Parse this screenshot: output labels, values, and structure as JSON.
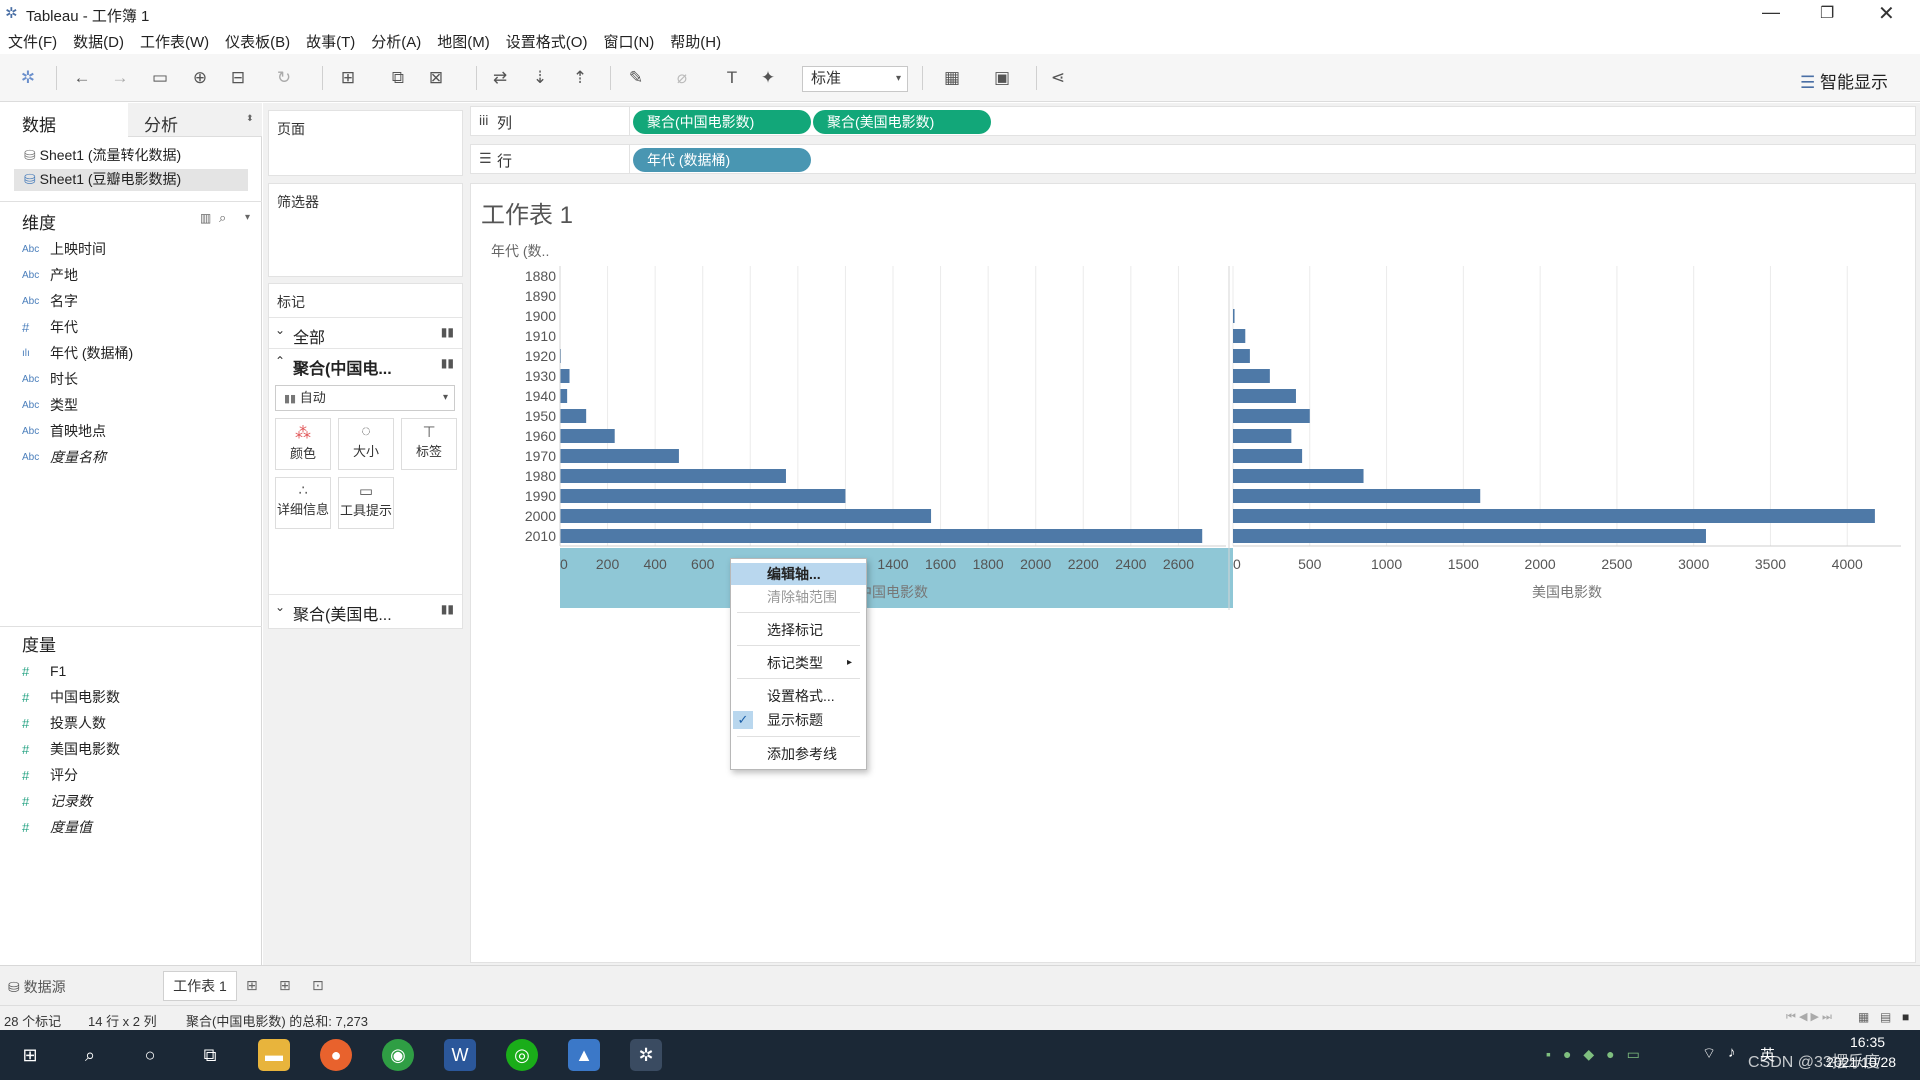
{
  "window": {
    "app_icon": "tableau-logo-icon",
    "title": "Tableau - 工作簿 1"
  },
  "menu": [
    "文件(F)",
    "数据(D)",
    "工作表(W)",
    "仪表板(B)",
    "故事(T)",
    "分析(A)",
    "地图(M)",
    "设置格式(O)",
    "窗口(N)",
    "帮助(H)"
  ],
  "toolbar": {
    "fit_select": "标准",
    "show_me": "智能显示"
  },
  "data_pane": {
    "tab_data": "数据",
    "tab_analysis": "分析",
    "sources": [
      "Sheet1 (流量转化数据)",
      "Sheet1 (豆瓣电影数据)"
    ],
    "dimensions_header": "维度",
    "dimensions": [
      {
        "type": "Abc",
        "name": "上映时间"
      },
      {
        "type": "Abc",
        "name": "产地"
      },
      {
        "type": "Abc",
        "name": "名字"
      },
      {
        "type": "#",
        "name": "年代"
      },
      {
        "type": "bins",
        "name": "年代 (数据桶)"
      },
      {
        "type": "Abc",
        "name": "时长"
      },
      {
        "type": "Abc",
        "name": "类型"
      },
      {
        "type": "Abc",
        "name": "首映地点"
      },
      {
        "type": "Abc",
        "name": "度量名称"
      }
    ],
    "measures_header": "度量",
    "measures": [
      {
        "type": "#",
        "name": "F1"
      },
      {
        "type": "#",
        "name": "中国电影数"
      },
      {
        "type": "#",
        "name": "投票人数"
      },
      {
        "type": "#",
        "name": "美国电影数"
      },
      {
        "type": "#",
        "name": "评分"
      },
      {
        "type": "#",
        "name": "记录数"
      },
      {
        "type": "#",
        "name": "度量值"
      }
    ]
  },
  "cards": {
    "pages": "页面",
    "filters": "筛选器",
    "marks": "标记",
    "all": "全部",
    "agg_china": "聚合(中国电...",
    "mark_type": "自动",
    "color": "颜色",
    "size": "大小",
    "label": "标签",
    "detail": "详细信息",
    "tooltip": "工具提示",
    "agg_us": "聚合(美国电..."
  },
  "shelves": {
    "columns_label": "列",
    "rows_label": "行",
    "col_pills": [
      "聚合(中国电影数)",
      "聚合(美国电影数)"
    ],
    "row_pills": [
      "年代 (数据桶)"
    ]
  },
  "sheet_title": "工作表 1",
  "chart_data": {
    "type": "bar",
    "orientation": "horizontal",
    "row_header": "年代 (数..",
    "categories": [
      "1880",
      "1890",
      "1900",
      "1910",
      "1920",
      "1930",
      "1940",
      "1950",
      "1960",
      "1970",
      "1980",
      "1990",
      "2000",
      "2010"
    ],
    "series": [
      {
        "name": "中国电影数",
        "values": [
          0,
          0,
          0,
          0,
          3,
          40,
          30,
          110,
          230,
          500,
          950,
          1200,
          1560,
          2700
        ],
        "ticks": [
          0,
          200,
          400,
          600,
          800,
          1000,
          1200,
          1400,
          1600,
          1800,
          2000,
          2200,
          2400,
          2600
        ],
        "xlim": [
          0,
          2800
        ],
        "xlabel": "中国电影数"
      },
      {
        "name": "美国电影数",
        "values": [
          0,
          0,
          10,
          80,
          110,
          240,
          410,
          500,
          380,
          450,
          850,
          1610,
          4180,
          3080
        ],
        "ticks": [
          0,
          500,
          1000,
          1500,
          2000,
          2500,
          3000,
          3500,
          4000
        ],
        "xlim": [
          0,
          4350
        ],
        "xlabel": "美国电影数"
      }
    ],
    "bar_color": "#4e79a7",
    "grid": true
  },
  "context_menu": [
    {
      "label": "编辑轴...",
      "state": "highlighted"
    },
    {
      "label": "清除轴范围",
      "state": "disabled"
    },
    {
      "label": "选择标记",
      "state": "normal"
    },
    {
      "label": "标记类型",
      "state": "submenu"
    },
    {
      "label": "设置格式...",
      "state": "normal"
    },
    {
      "label": "显示标题",
      "state": "checked"
    },
    {
      "label": "添加参考线",
      "state": "normal"
    }
  ],
  "tabs": {
    "datasource": "数据源",
    "sheet": "工作表 1"
  },
  "status": {
    "marks": "28 个标记",
    "dims": "14 行 x 2 列",
    "sum": "聚合(中国电影数) 的总和: 7,273"
  },
  "taskbar": {
    "time": "16:35",
    "date": "2021/10/28",
    "ime": "英",
    "watermark": "CSDN @33摆乐度"
  }
}
